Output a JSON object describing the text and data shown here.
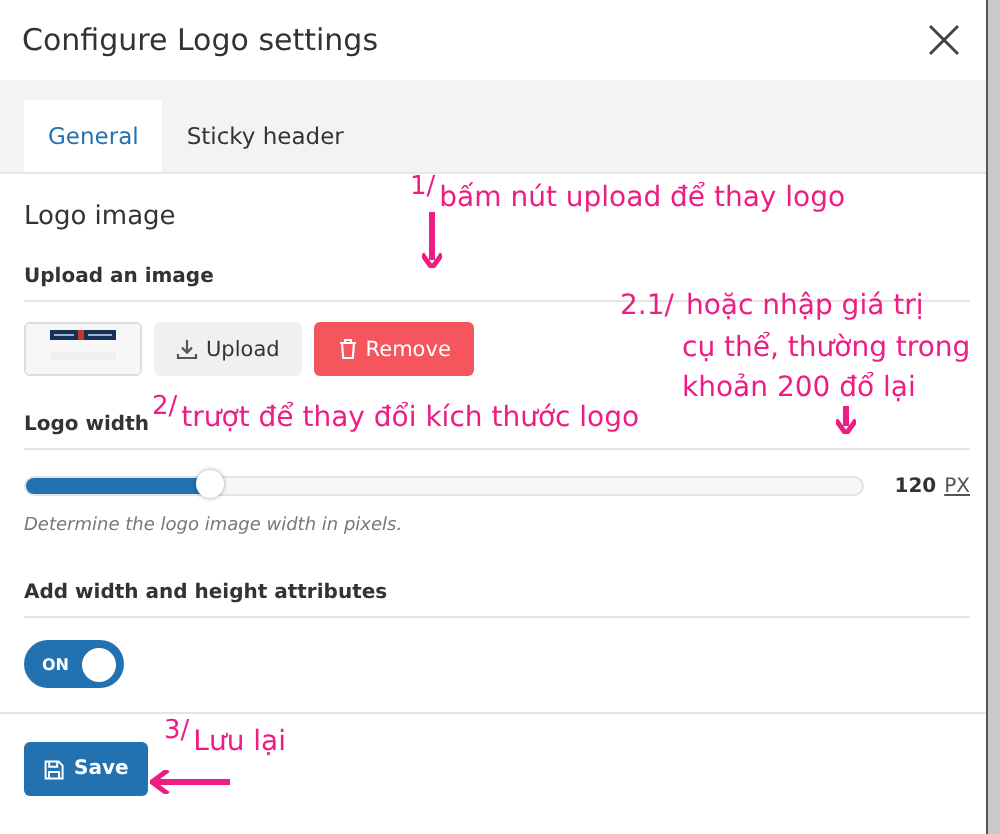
{
  "window": {
    "title": "Configure Logo settings"
  },
  "tabs": [
    {
      "label": "General",
      "selected": true
    },
    {
      "label": "Sticky header",
      "selected": false
    }
  ],
  "logo_image": {
    "heading": "Logo image",
    "upload_label": "Upload an image",
    "buttons": [
      {
        "kind": "upload",
        "label": "Upload"
      },
      {
        "kind": "remove",
        "label": "Remove"
      }
    ]
  },
  "logo_width": {
    "label": "Logo width",
    "level": 0.22,
    "value": "120",
    "unit": "PX",
    "hint": "Determine the logo image width in pixels."
  },
  "size_attributes": {
    "label": "Add width and height attributes",
    "toggle_label": "ON",
    "on": true
  },
  "footer": {
    "save_label": "Save"
  },
  "annotations": [
    {
      "number": "1/",
      "text": "bấm nút upload để thay logo",
      "kind": "down"
    },
    {
      "number": "2/",
      "text": "trượt để thay đổi kích thước logo"
    },
    {
      "number": "2.1/",
      "text": "hoặc nhập giá trị",
      "lines": [
        "cụ thể, thường trong",
        "khoản 200 đổ lại"
      ],
      "kind": "down"
    },
    {
      "number": "3/",
      "text": "Lưu lại",
      "kind": "left"
    }
  ]
}
